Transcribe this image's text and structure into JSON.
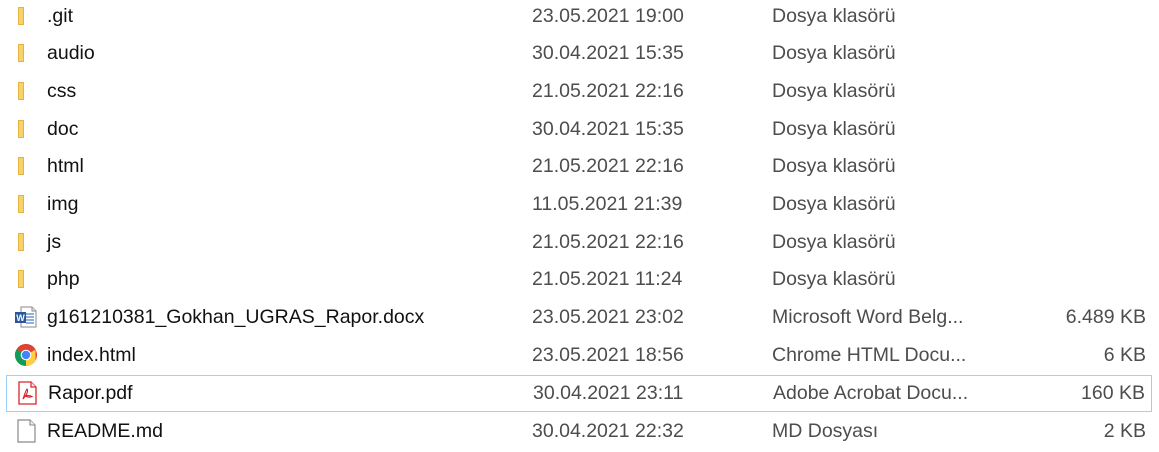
{
  "files": [
    {
      "name": ".git",
      "date": "23.05.2021 19:00",
      "type": "Dosya klasörü",
      "size": "",
      "icon": "folder-icon"
    },
    {
      "name": "audio",
      "date": "30.04.2021 15:35",
      "type": "Dosya klasörü",
      "size": "",
      "icon": "folder-icon"
    },
    {
      "name": "css",
      "date": "21.05.2021 22:16",
      "type": "Dosya klasörü",
      "size": "",
      "icon": "folder-icon"
    },
    {
      "name": "doc",
      "date": "30.04.2021 15:35",
      "type": "Dosya klasörü",
      "size": "",
      "icon": "folder-icon"
    },
    {
      "name": "html",
      "date": "21.05.2021 22:16",
      "type": "Dosya klasörü",
      "size": "",
      "icon": "folder-icon"
    },
    {
      "name": "img",
      "date": "11.05.2021 21:39",
      "type": "Dosya klasörü",
      "size": "",
      "icon": "folder-icon"
    },
    {
      "name": "js",
      "date": "21.05.2021 22:16",
      "type": "Dosya klasörü",
      "size": "",
      "icon": "folder-icon"
    },
    {
      "name": "php",
      "date": "21.05.2021 11:24",
      "type": "Dosya klasörü",
      "size": "",
      "icon": "folder-icon"
    },
    {
      "name": "g161210381_Gokhan_UGRAS_Rapor.docx",
      "date": "23.05.2021 23:02",
      "type": "Microsoft Word Belg...",
      "size": "6.489 KB",
      "icon": "word-document-icon"
    },
    {
      "name": "index.html",
      "date": "23.05.2021 18:56",
      "type": "Chrome HTML Docu...",
      "size": "6 KB",
      "icon": "chrome-icon"
    },
    {
      "name": "Rapor.pdf",
      "date": "30.04.2021 23:11",
      "type": "Adobe Acrobat Docu...",
      "size": "160 KB",
      "icon": "pdf-icon"
    },
    {
      "name": "README.md",
      "date": "30.04.2021 22:32",
      "type": "MD Dosyası",
      "size": "2 KB",
      "icon": "blank-file-icon"
    }
  ],
  "selected_file": "Rapor.pdf",
  "colors": {
    "folder": "#f3c24b",
    "word_blue": "#2b579a",
    "pdf_red": "#d9252a",
    "selection_border": "#99d1ff"
  }
}
